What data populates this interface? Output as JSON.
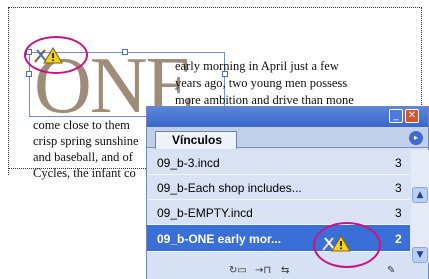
{
  "document": {
    "drop_cap_word": "ONE",
    "story_lines_right": [
      "early morning in April just a few",
      "years ago, two young men possess",
      "more ambition and drive than mone"
    ],
    "story_lines_left": [
      "come close to them",
      "crisp spring sunshine",
      "and baseball, and of",
      "Cycles, the infant co",
      "                          "
    ]
  },
  "links_panel": {
    "tab_label": "Vínculos",
    "window_buttons": {
      "minimize": "_",
      "close": "✕"
    },
    "menu_glyph": "▸",
    "rows": [
      {
        "name": "09_b-3.incd",
        "page": "3",
        "selected": false,
        "status_icon": ""
      },
      {
        "name": "09_b-Each shop includes...",
        "page": "3",
        "selected": false,
        "status_icon": ""
      },
      {
        "name": "09_b-EMPTY.incd",
        "page": "3",
        "selected": false,
        "status_icon": ""
      },
      {
        "name": "09_b-ONE early mor...",
        "page": "2",
        "selected": true,
        "status_icon": "modified-link-warning-icon"
      }
    ],
    "scroll": {
      "up": "▲",
      "down": "▼"
    },
    "bottom_tools": [
      "relink-icon",
      "go-to-link-icon",
      "update-link-icon",
      "edit-original-icon"
    ]
  },
  "colors": {
    "accent": "#3b6fd8",
    "highlight_ring": "#cc1180",
    "drop_cap": "#9f8c78"
  }
}
